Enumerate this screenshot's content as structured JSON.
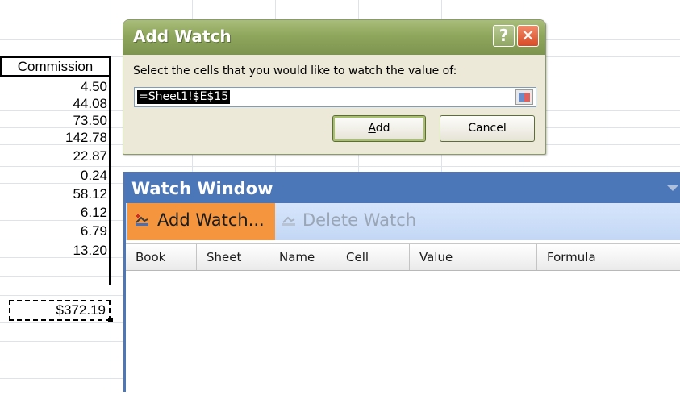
{
  "sheet": {
    "column_header": "Commission",
    "values": [
      "4.50",
      "44.08",
      "73.50",
      "142.78",
      "22.87",
      "0.24",
      "58.12",
      "6.12",
      "6.79",
      "13.20"
    ],
    "total": "$372.19"
  },
  "add_watch_dialog": {
    "title": "Add Watch",
    "help_label": "?",
    "close_label": "✕",
    "prompt": "Select the cells that you would like to watch the value of:",
    "reference": "=Sheet1!$E$15",
    "add_button_prefix": "",
    "add_button_underlined": "A",
    "add_button_rest": "dd",
    "cancel_button": "Cancel"
  },
  "watch_window": {
    "title": "Watch Window",
    "add_watch_label": "Add Watch...",
    "delete_watch_label": "Delete Watch",
    "columns": [
      "Book",
      "Sheet",
      "Name",
      "Cell",
      "Value",
      "Formula"
    ]
  },
  "colors": {
    "dialog_title": "#8ea65c",
    "watch_title": "#4b76b7",
    "toolbar_highlight": "#f5963f"
  }
}
